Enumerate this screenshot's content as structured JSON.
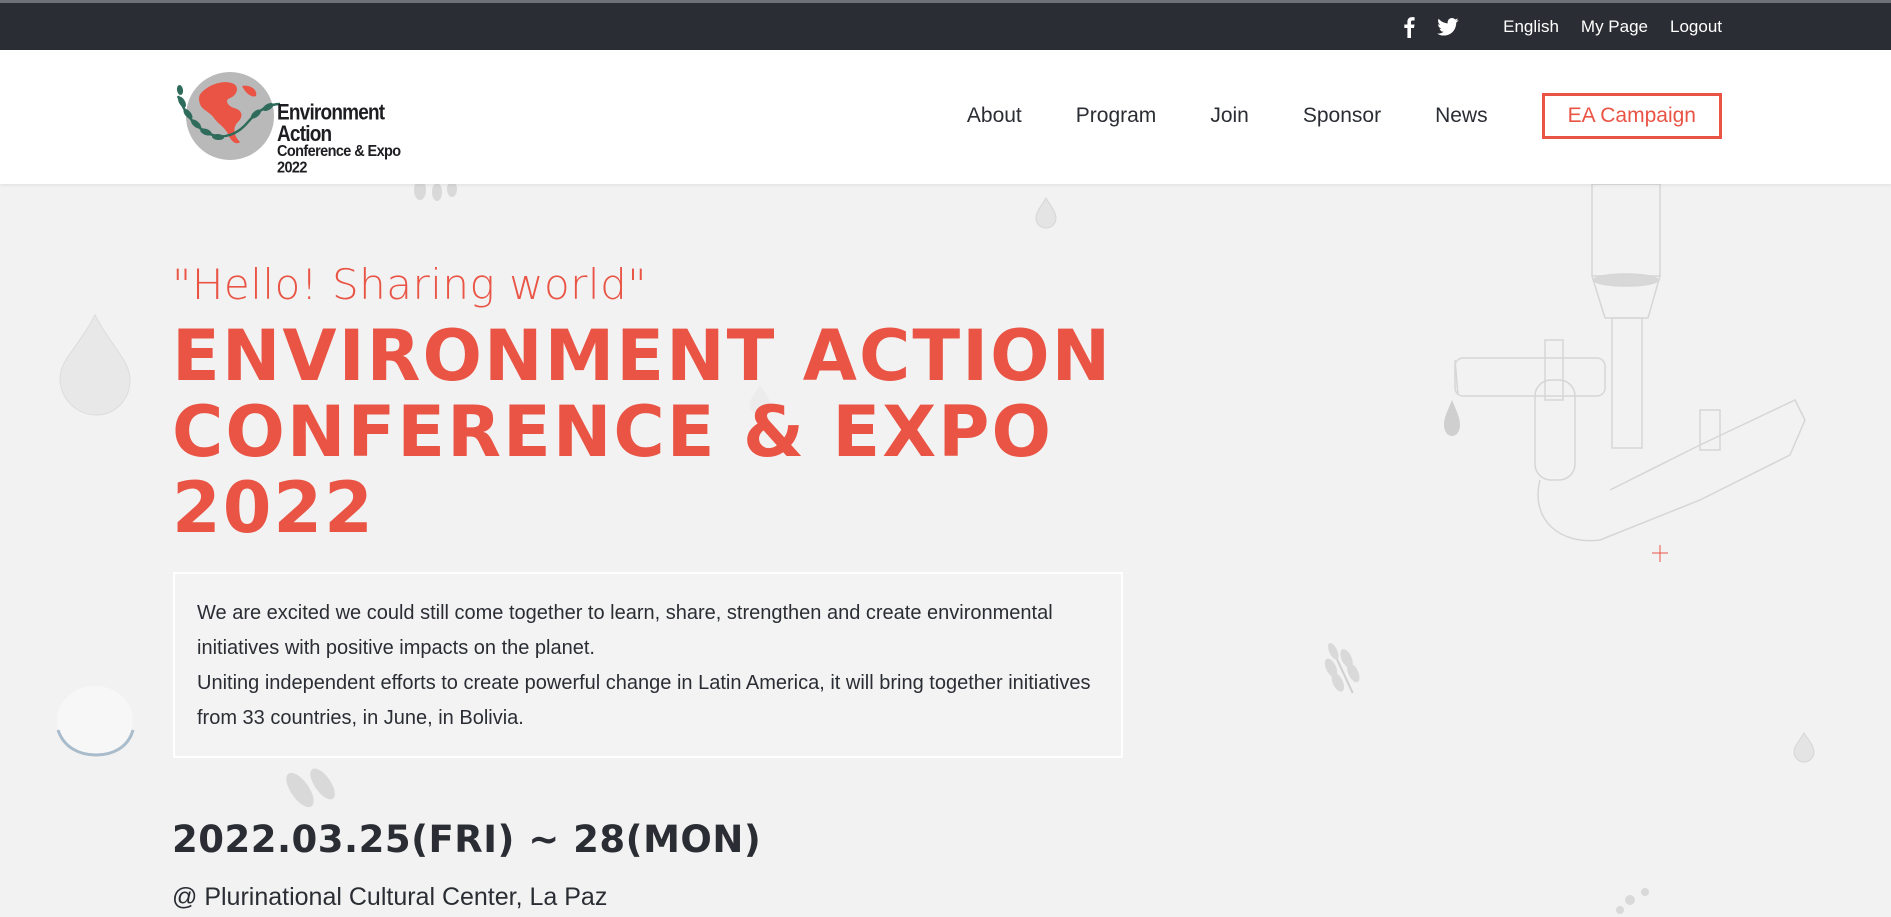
{
  "topbar": {
    "icons": [
      "facebook-icon",
      "twitter-icon"
    ],
    "language": "English",
    "my_page": "My Page",
    "logout": "Logout"
  },
  "logo": {
    "line1": "Environment Action",
    "line2": "Conference & Expo 2022"
  },
  "nav": {
    "items": [
      "About",
      "Program",
      "Join",
      "Sponsor",
      "News"
    ],
    "campaign": "EA Campaign"
  },
  "hero": {
    "subtitle": "\"Hello! Sharing world\"",
    "title_lines": [
      "ENVIRONMENT ACTION",
      "CONFERENCE & EXPO",
      "2022"
    ],
    "intro_1": "We are excited we could still come together to learn, share, strengthen and create environmental initiatives with positive impacts on the planet.",
    "intro_2": "Uniting independent efforts to create powerful change in Latin America, it will bring together initiatives from 33 countries, in June, in Bolivia.",
    "date": "2022.03.25(FRI) ~ 28(MON)",
    "venue": "@ Plurinational Cultural Center, La Paz"
  },
  "colors": {
    "accent": "#e95445",
    "dark": "#2a2d33",
    "background": "#f2f2f2"
  }
}
